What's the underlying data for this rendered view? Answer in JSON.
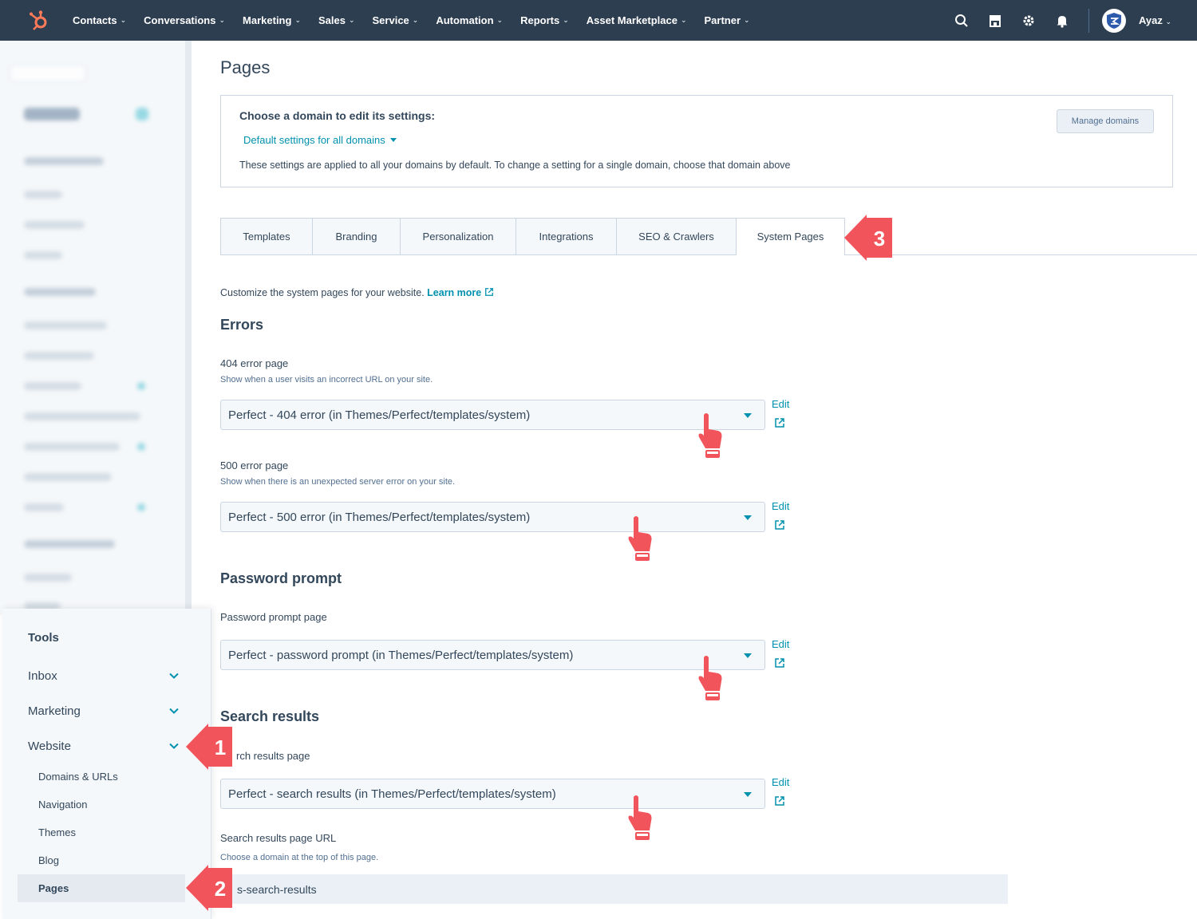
{
  "nav": {
    "items": [
      "Contacts",
      "Conversations",
      "Marketing",
      "Sales",
      "Service",
      "Automation",
      "Reports",
      "Asset Marketplace",
      "Partner"
    ],
    "user": "Ayaz"
  },
  "tools": {
    "title": "Tools",
    "sections": [
      "Inbox",
      "Marketing",
      "Website"
    ],
    "website_items": [
      "Domains & URLs",
      "Navigation",
      "Themes",
      "Blog",
      "Pages"
    ]
  },
  "page": {
    "title": "Pages",
    "domain_heading": "Choose a domain to edit its settings:",
    "domain_select": "Default settings for all domains",
    "domain_desc": "These settings are applied to all your domains by default. To change a setting for a single domain, choose that domain above",
    "manage_domains": "Manage domains"
  },
  "tabs": [
    "Templates",
    "Branding",
    "Personalization",
    "Integrations",
    "SEO & Crawlers",
    "System Pages"
  ],
  "intro": {
    "text": "Customize the system pages for your website.",
    "link": "Learn more"
  },
  "errors": {
    "heading": "Errors",
    "p404": {
      "label": "404 error page",
      "help": "Show when a user visits an incorrect URL on your site.",
      "value": "Perfect - 404 error (in Themes/Perfect/templates/system)"
    },
    "p500": {
      "label": "500 error page",
      "help": "Show when there is an unexpected server error on your site.",
      "value": "Perfect - 500 error (in Themes/Perfect/templates/system)"
    }
  },
  "password": {
    "heading": "Password prompt",
    "label": "Password prompt page",
    "value": "Perfect - password prompt (in Themes/Perfect/templates/system)"
  },
  "search": {
    "heading": "Search results",
    "label": "rch results page",
    "value": "Perfect - search results (in Themes/Perfect/templates/system)",
    "url_label": "Search results page URL",
    "url_help": "Choose a domain at the top of this page.",
    "url_value": "s-search-results"
  },
  "edit_label": "Edit",
  "callouts": [
    "1",
    "2",
    "3"
  ],
  "colors": {
    "nav_bg": "#2d3e50",
    "accent": "#0091ae",
    "callout": "#f2545b",
    "logo": "#ff7a59"
  }
}
